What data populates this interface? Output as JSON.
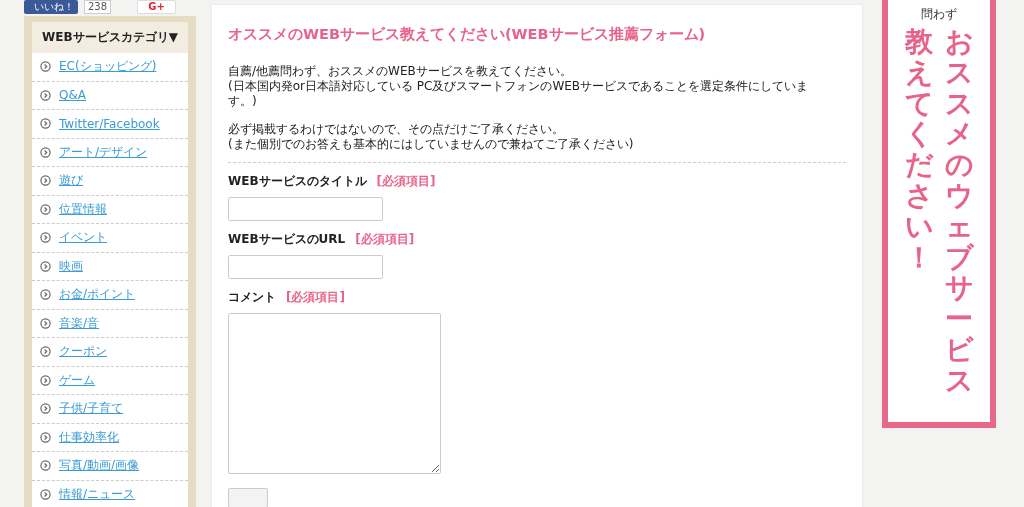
{
  "social": {
    "like_label": "いいね！",
    "like_count": "238",
    "gplus_label": "G+"
  },
  "sidebar": {
    "title": "WEBサービスカテゴリ▼",
    "items": [
      {
        "label": "EC(ショッピング)"
      },
      {
        "label": "Q&A"
      },
      {
        "label": "Twitter/Facebook"
      },
      {
        "label": "アート/デザイン"
      },
      {
        "label": "遊び"
      },
      {
        "label": "位置情報"
      },
      {
        "label": "イベント"
      },
      {
        "label": "映画"
      },
      {
        "label": "お金/ポイント"
      },
      {
        "label": "音楽/音"
      },
      {
        "label": "クーポン"
      },
      {
        "label": "ゲーム"
      },
      {
        "label": "子供/子育て"
      },
      {
        "label": "仕事効率化"
      },
      {
        "label": "写真/動画/画像"
      },
      {
        "label": "情報/ニュース"
      }
    ]
  },
  "form": {
    "title": "オススメのWEBサービス教えてください(WEBサービス推薦フォーム)",
    "intro": [
      "自薦/他薦問わず、おススメのWEBサービスを教えてください。",
      "(日本国内発or日本語対応している PC及びスマートフォンのWEBサービスであることを選定条件にしています。)"
    ],
    "notice": [
      "必ず掲載するわけではないので、その点だけご了承ください。",
      "(また個別でのお答えも基本的にはしていませんので兼ねてご了承ください)"
    ],
    "fields": [
      {
        "kind": "input",
        "label": "WEBサービスのタイトル",
        "required": "[必須項目]"
      },
      {
        "kind": "input",
        "label": "WEBサービスのURL",
        "required": "[必須項目]"
      },
      {
        "kind": "textarea",
        "label": "コメント",
        "required": "[必須項目]"
      }
    ]
  },
  "banner": {
    "subtitle": "問わず",
    "column_right": "おススメのウェブサービス",
    "column_left": "教えてください！"
  }
}
